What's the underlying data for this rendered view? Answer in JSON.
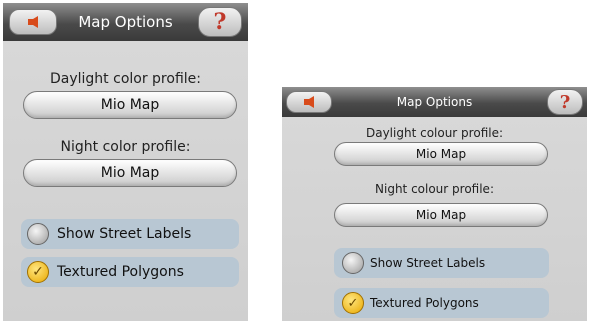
{
  "left": {
    "title": "Map Options",
    "daylight_label": "Daylight color profile:",
    "daylight_value": "Mio Map",
    "night_label": "Night color profile:",
    "night_value": "Mio Map",
    "street_labels": "Show Street Labels",
    "street_labels_checked": false,
    "textured": "Textured Polygons",
    "textured_checked": true,
    "help_symbol": "?"
  },
  "right": {
    "title": "Map Options",
    "daylight_label": "Daylight colour profile:",
    "daylight_value": "Mio Map",
    "night_label": "Night colour profile:",
    "night_value": "Mio Map",
    "street_labels": "Show Street Labels",
    "street_labels_checked": false,
    "textured": "Textured Polygons",
    "textured_checked": true,
    "help_symbol": "?"
  },
  "colors": {
    "title_bar": "#4a4a4a",
    "background": "#d4d4d4",
    "option_row": "#b8c7d3",
    "back_arrow": "#d84b1b",
    "check_fill": "#e8a800"
  },
  "icons": [
    "back-arrow-icon",
    "help-question-icon",
    "radio-unchecked-icon",
    "checkmark-icon"
  ]
}
